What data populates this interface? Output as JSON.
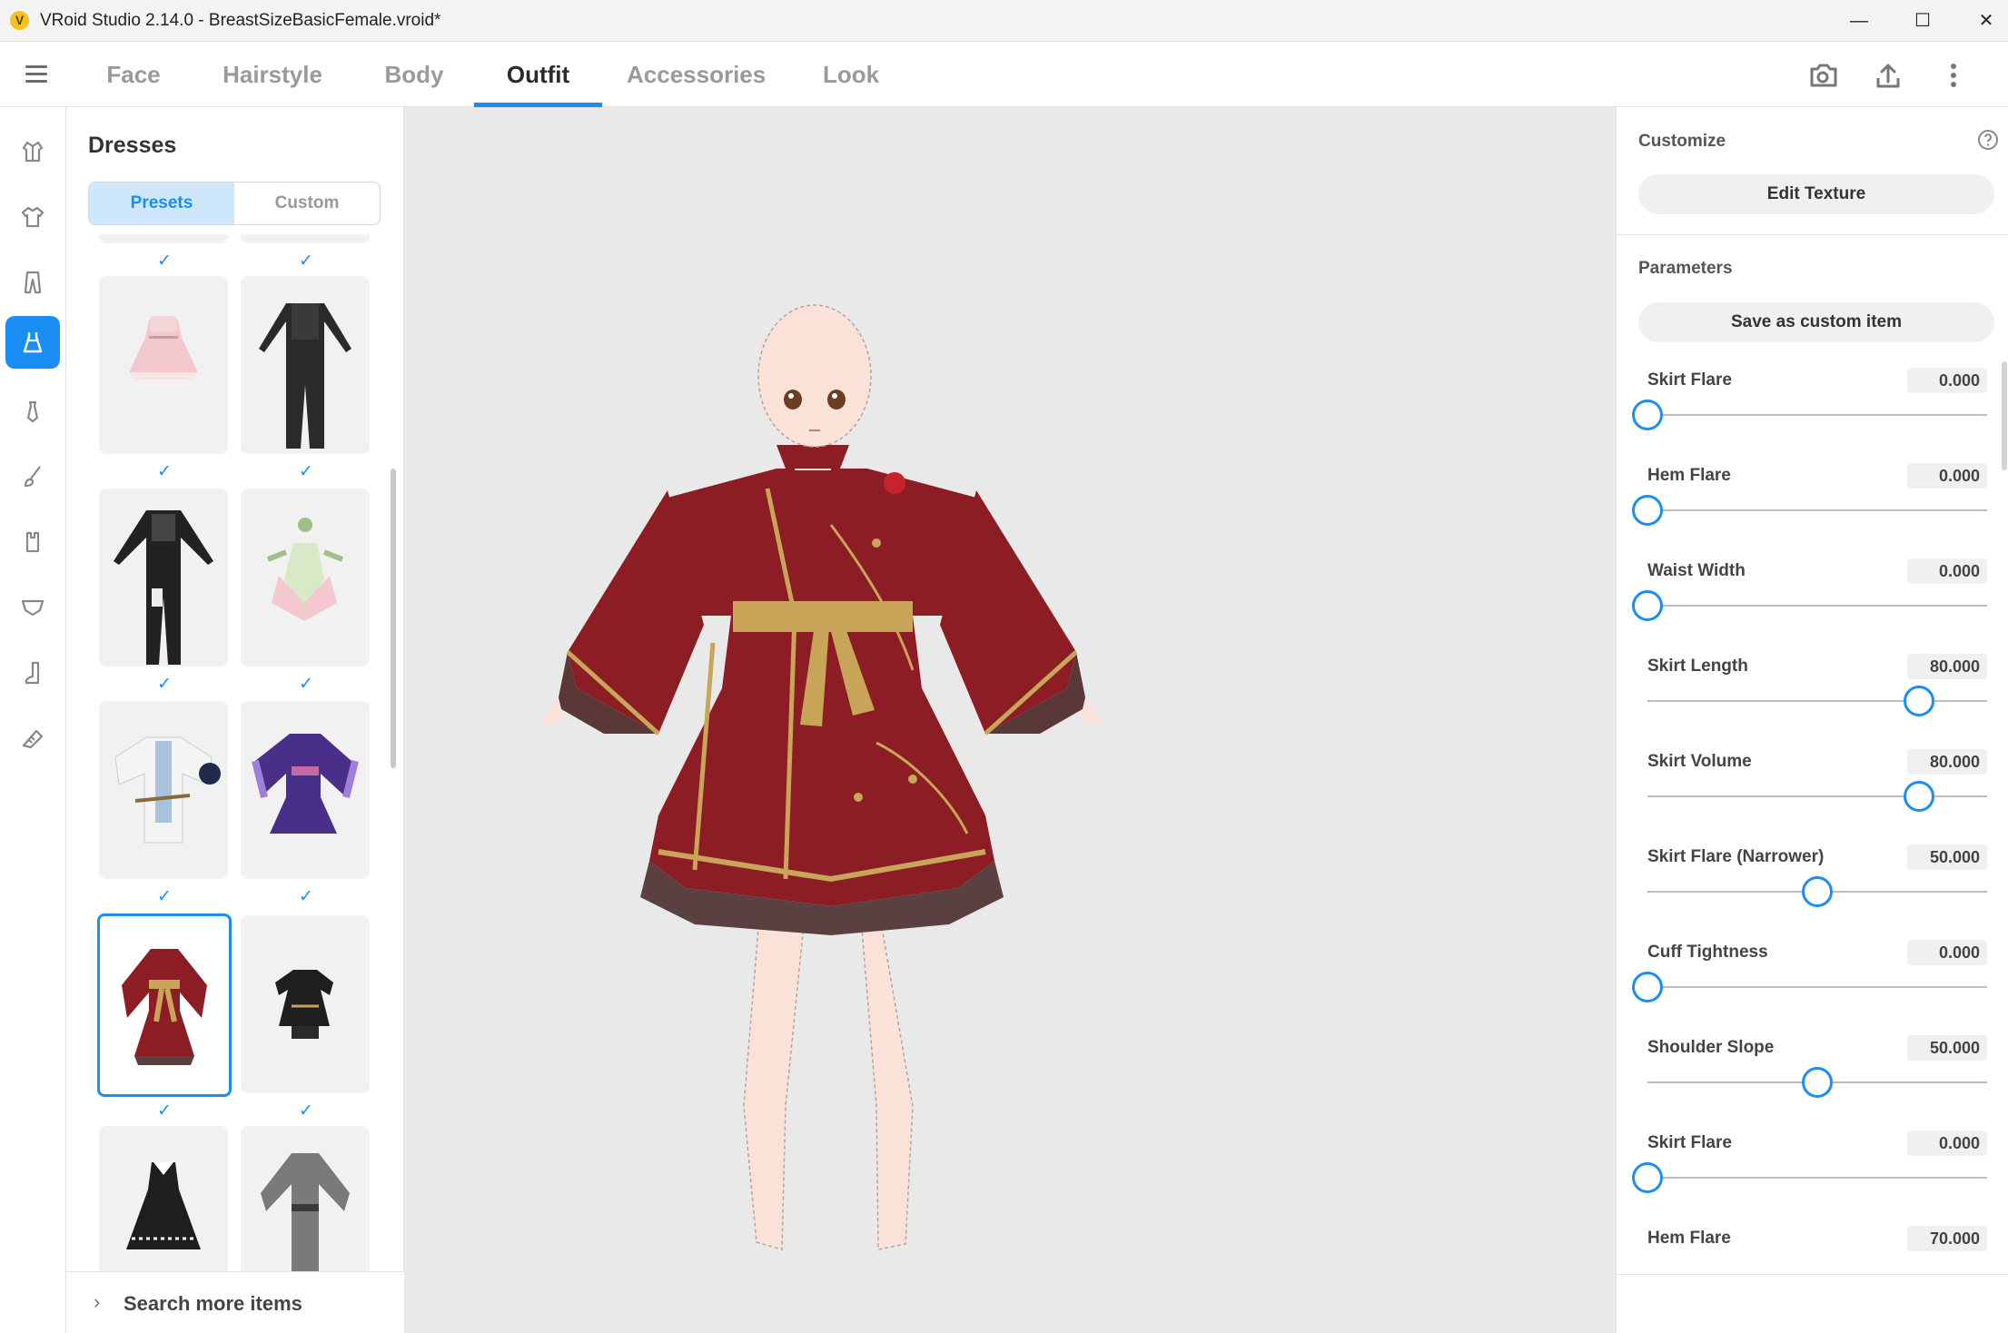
{
  "window": {
    "title": "VRoid Studio 2.14.0 - BreastSizeBasicFemale.vroid*",
    "controls": [
      "minimize",
      "maximize",
      "close"
    ]
  },
  "tabs": [
    {
      "label": "Face",
      "active": false
    },
    {
      "label": "Hairstyle",
      "active": false
    },
    {
      "label": "Body",
      "active": false
    },
    {
      "label": "Outfit",
      "active": true
    },
    {
      "label": "Accessories",
      "active": false
    },
    {
      "label": "Look",
      "active": false
    }
  ],
  "top_icons": [
    "camera-icon",
    "export-icon",
    "more-vertical-icon"
  ],
  "rail": {
    "items": [
      "hood-icon",
      "shirt-icon",
      "pants-icon",
      "dress-icon",
      "tie-icon",
      "brush-icon",
      "glove-icon",
      "bra-icon",
      "sock-icon",
      "shoe-icon"
    ],
    "active_index": 3
  },
  "dresses_panel": {
    "title": "Dresses",
    "segment": {
      "presets": "Presets",
      "custom": "Custom",
      "active": "presets"
    },
    "items": [
      {
        "name": "pink-lolita-dress",
        "selected": false
      },
      {
        "name": "black-bodysuit",
        "selected": false
      },
      {
        "name": "black-armor-suit",
        "selected": false
      },
      {
        "name": "flower-fairy-dress",
        "selected": false
      },
      {
        "name": "white-blue-coat",
        "selected": false
      },
      {
        "name": "purple-kimono-dress",
        "selected": false
      },
      {
        "name": "red-qipao-dress",
        "selected": true
      },
      {
        "name": "black-gold-shortdress",
        "selected": false
      },
      {
        "name": "black-maid-dress",
        "selected": false
      },
      {
        "name": "gray-robe",
        "selected": false
      }
    ],
    "search_more": "Search more items"
  },
  "customize": {
    "title": "Customize",
    "edit_texture": "Edit Texture",
    "help_icon": "help-circle-icon"
  },
  "parameters": {
    "title": "Parameters",
    "save_custom": "Save as custom item",
    "items": [
      {
        "label": "Skirt Flare",
        "value": "0.000",
        "level": 0.0
      },
      {
        "label": "Hem Flare",
        "value": "0.000",
        "level": 0.0
      },
      {
        "label": "Waist Width",
        "value": "0.000",
        "level": 0.0
      },
      {
        "label": "Skirt Length",
        "value": "80.000",
        "level": 0.8
      },
      {
        "label": "Skirt Volume",
        "value": "80.000",
        "level": 0.8
      },
      {
        "label": "Skirt Flare (Narrower)",
        "value": "50.000",
        "level": 0.5
      },
      {
        "label": "Cuff Tightness",
        "value": "0.000",
        "level": 0.0
      },
      {
        "label": "Shoulder Slope",
        "value": "50.000",
        "level": 0.5
      },
      {
        "label": "Skirt Flare",
        "value": "0.000",
        "level": 0.0
      },
      {
        "label": "Hem Flare",
        "value": "70.000",
        "level": 0.7
      }
    ]
  },
  "colors": {
    "accent": "#1a8ef5",
    "viewport_bg": "#e9e9e9",
    "dress_red": "#8c1d24",
    "dress_gold": "#c9a55a"
  }
}
